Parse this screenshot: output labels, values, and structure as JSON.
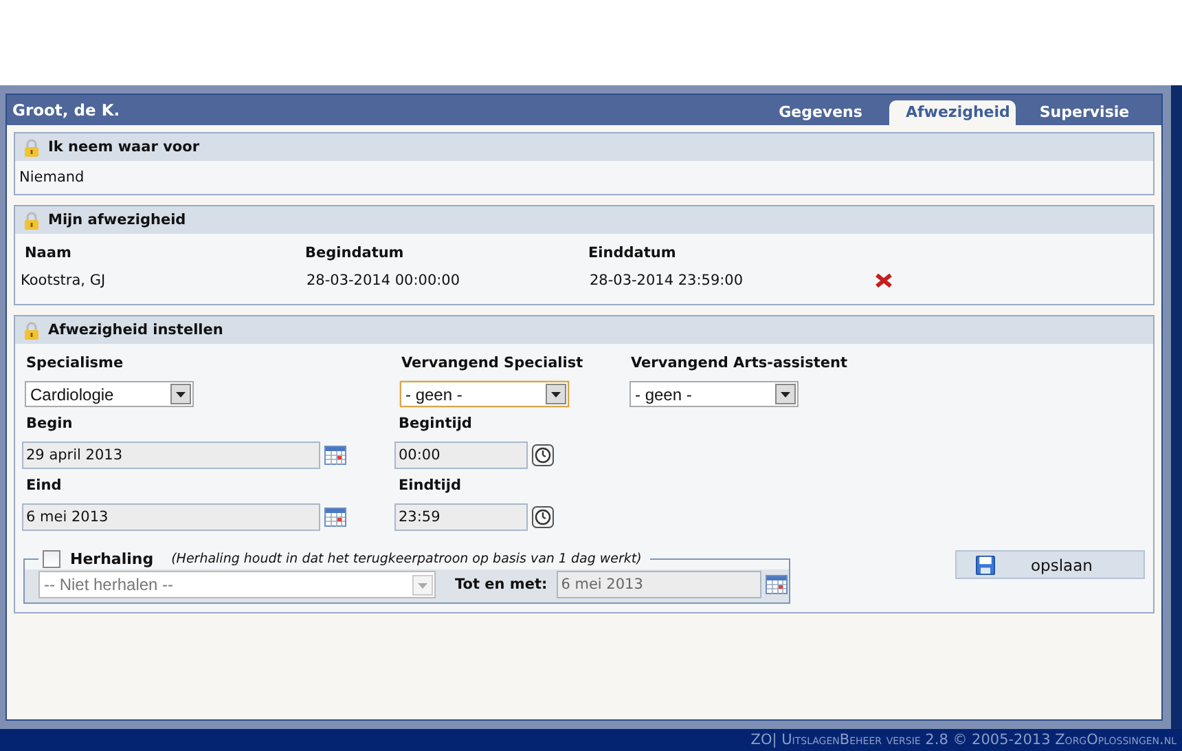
{
  "header": {
    "title": "Groot, de K.",
    "tabs": [
      {
        "label": "Gegevens",
        "selected": false
      },
      {
        "label": "Afwezigheid",
        "selected": true
      },
      {
        "label": "Supervisie",
        "selected": false
      }
    ]
  },
  "substitute_for": {
    "title": "Ik neem waar voor",
    "text": "Niemand"
  },
  "my_absence": {
    "title": "Mijn afwezigheid",
    "columns": [
      "Naam",
      "Begindatum",
      "Einddatum"
    ],
    "rows": [
      {
        "cells": [
          "Kootstra, GJ",
          "28-03-2014 00:00:00",
          "28-03-2014 23:59:00"
        ]
      }
    ]
  },
  "set_absence": {
    "title": "Afwezigheid instellen",
    "selects": [
      {
        "label": "Specialisme",
        "value": "Cardiologie",
        "focused": false
      },
      {
        "label": "Vervangend Specialist",
        "value": "- geen -",
        "focused": true
      },
      {
        "label": "Vervangend Arts-assistent",
        "value": "- geen -",
        "focused": false
      }
    ],
    "dates": [
      {
        "label": "Begin",
        "value": "29 april 2013"
      },
      {
        "label": "Eind",
        "value": "6 mei 2013"
      }
    ],
    "times": [
      {
        "label": "Begintijd",
        "value": "00:00"
      },
      {
        "label": "Eindtijd",
        "value": "23:59"
      }
    ],
    "repeat": {
      "checked": false,
      "label": "Herhaling",
      "hint": "(Herhaling houdt in dat het terugkeerpatroon op basis van 1 dag werkt)",
      "select": {
        "value": "-- Niet herhalen --",
        "disabled": true
      },
      "until_label": "Tot en met:",
      "until_value": "6 mei 2013"
    },
    "save_button": "opslaan"
  },
  "footer": "ZO| UitslagenBeheer versie 2.8 © 2005-2013 ZorgOplossingen.nl"
}
